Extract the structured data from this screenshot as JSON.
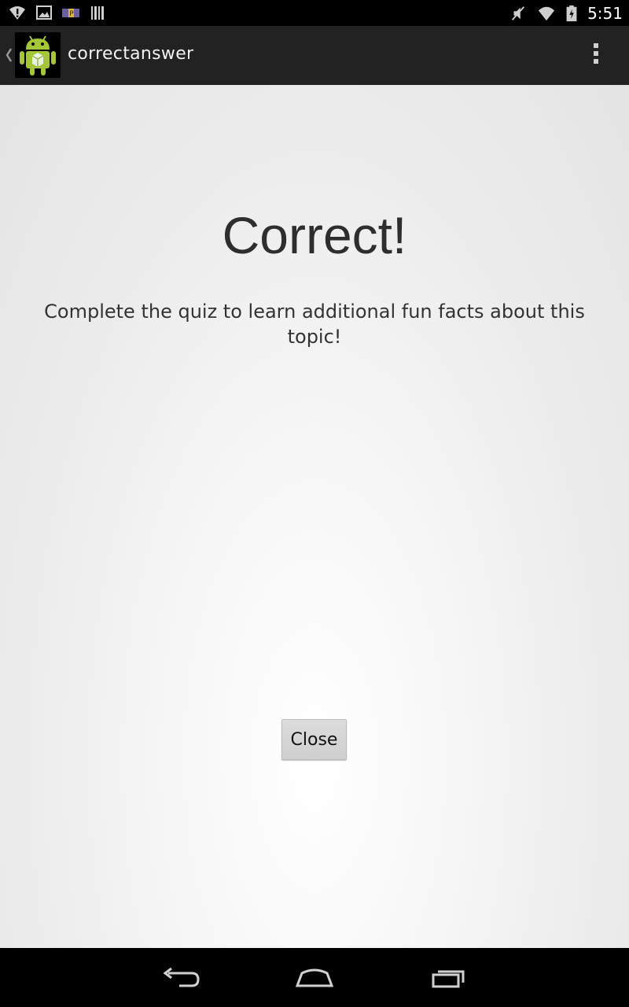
{
  "status_bar": {
    "time": "5:51",
    "icons_left": [
      "wifi-alert-icon",
      "image-icon",
      "parking-icon",
      "barcode-icon"
    ],
    "icons_right": [
      "mute-icon",
      "wifi-icon",
      "battery-charging-icon"
    ]
  },
  "action_bar": {
    "title": "correctanswer",
    "icons": [
      "up-caret-icon",
      "android-app-icon",
      "overflow-menu-icon"
    ]
  },
  "main": {
    "heading": "Correct!",
    "message": "Complete the quiz to learn additional fun facts about this topic!",
    "close_label": "Close"
  },
  "nav_bar": {
    "icons": [
      "back-icon",
      "home-icon",
      "recents-icon"
    ]
  },
  "colors": {
    "action_bar_bg": "#222222",
    "status_bar_bg": "#000000",
    "content_bg": "#eeeeee",
    "android_green": "#a4c639"
  }
}
